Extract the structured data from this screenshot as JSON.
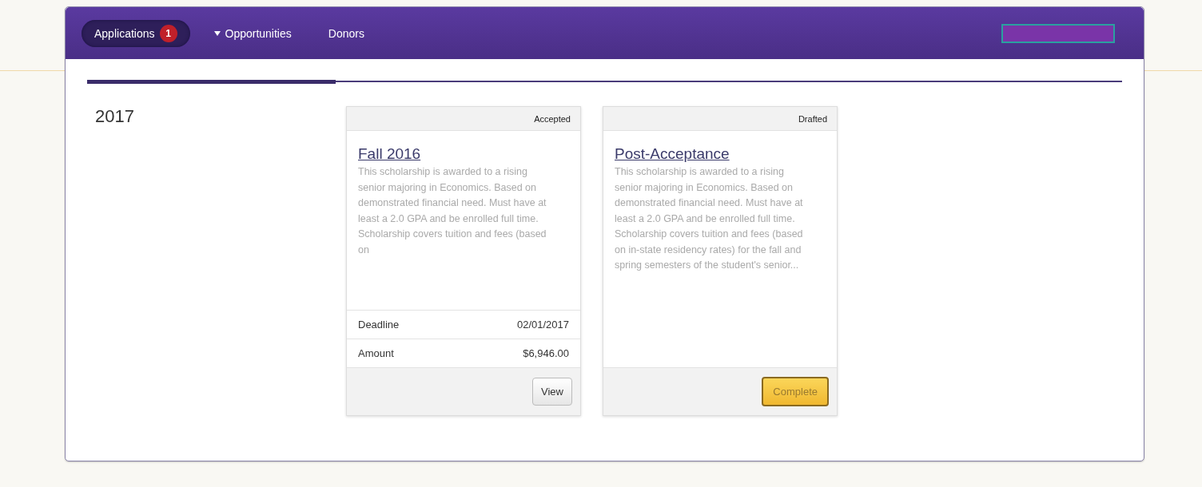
{
  "nav": {
    "items": [
      {
        "label": "Applications",
        "badge": "1",
        "selected": true,
        "caret": false
      },
      {
        "label": "Opportunities",
        "selected": false,
        "caret": true
      },
      {
        "label": "Donors",
        "selected": false,
        "caret": false
      }
    ]
  },
  "progress": {
    "level": 0.24
  },
  "year": "2017",
  "cards": [
    {
      "status": "Accepted",
      "title": "Fall 2016",
      "description": "This scholarship is awarded to a rising senior majoring in Economics. Based on demonstrated financial need. Must have at least a 2.0 GPA and be enrolled full time. Scholarship covers tuition and fees (based on",
      "details": [
        {
          "label": "Deadline",
          "value": "02/01/2017"
        },
        {
          "label": "Amount",
          "value": "$6,946.00"
        }
      ],
      "button": {
        "label": "View",
        "kind": "default"
      }
    },
    {
      "status": "Drafted",
      "title": "Post-Acceptance",
      "description": "This scholarship is awarded to a rising senior majoring in Economics. Based on demonstrated financial need. Must have at least a 2.0 GPA and be enrolled full time. Scholarship covers tuition and fees (based on in-state residency rates) for the fall and spring semesters of the student's senior...",
      "button": {
        "label": "Complete",
        "kind": "primary"
      }
    }
  ]
}
